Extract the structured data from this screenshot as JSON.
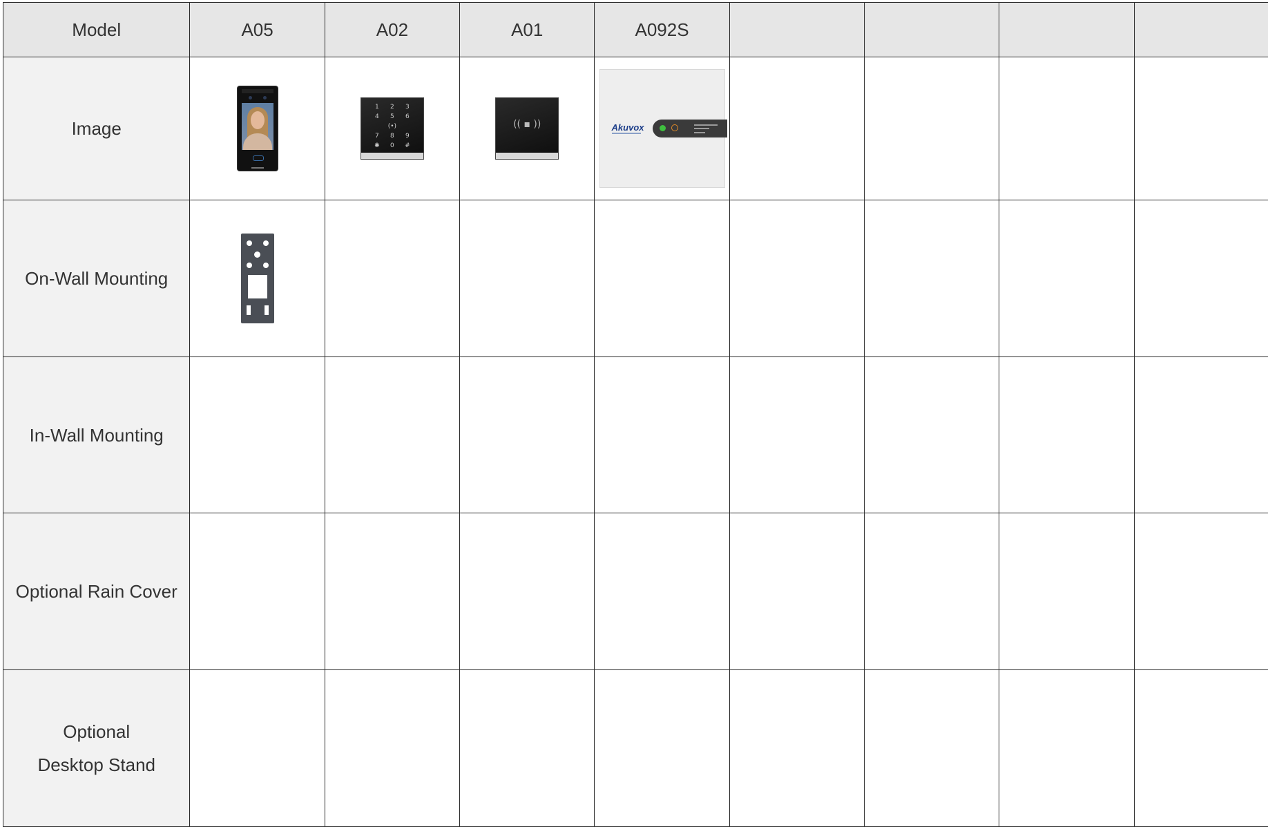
{
  "header": {
    "label": "Model",
    "columns": [
      "A05",
      "A02",
      "A01",
      "A092S",
      "",
      "",
      "",
      ""
    ]
  },
  "rows": {
    "image": "Image",
    "on_wall": "On-Wall Mounting",
    "in_wall": "In-Wall Mounting",
    "rain_cover": "Optional Rain Cover",
    "desktop_stand_line1": "Optional",
    "desktop_stand_line2": "Desktop Stand"
  },
  "products": {
    "a02_keys": [
      "1",
      "2",
      "3",
      "4",
      "5",
      "6",
      "(•)",
      "",
      "",
      "7",
      "8",
      "9",
      "✱",
      "0",
      "#"
    ],
    "a01_symbol": "(( ▪ ))",
    "a092_logo": "Akuvox"
  },
  "colors": {
    "header_bg": "#e6e6e6",
    "label_bg": "#f2f2f2",
    "border": "#2a2a2a",
    "text": "#333333"
  }
}
